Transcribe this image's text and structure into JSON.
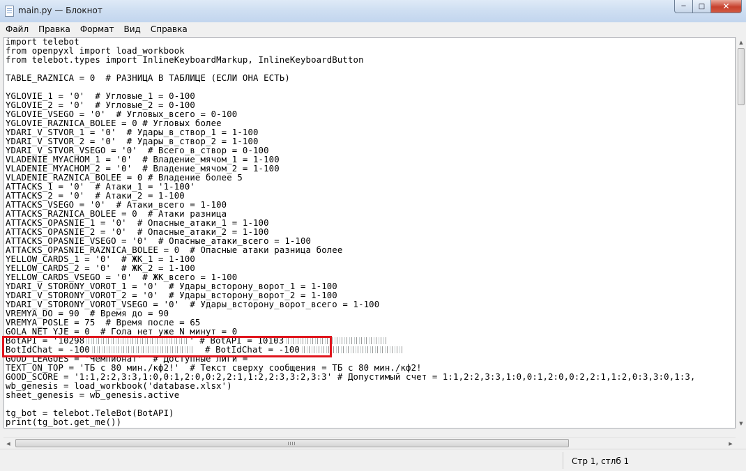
{
  "window": {
    "title": "main.py — Блокнот",
    "controls": {
      "minimize": "─",
      "maximize": "□",
      "close": "✕"
    }
  },
  "menu": [
    "Файл",
    "Правка",
    "Формат",
    "Вид",
    "Справка"
  ],
  "editor": {
    "lines": [
      "import telebot",
      "from openpyxl import load_workbook",
      "from telebot.types import InlineKeyboardMarkup, InlineKeyboardButton",
      "",
      "TABLE_RAZNICA = 0  # РАЗНИЦА В ТАБЛИЦЕ (ЕСЛИ ОНА ЕСТЬ)",
      "",
      "YGLOVIE_1 = '0'  # Угловые_1 = 0-100",
      "YGLOVIE_2 = '0'  # Угловые_2 = 0-100",
      "YGLOVIE_VSEGO = '0'  # Угловых_всего = 0-100",
      "YGLOVIE_RAZNICA_BOLEE = 0 # Угловых более",
      "YDARI_V_STVOR_1 = '0'  # Удары_в_створ_1 = 1-100",
      "YDARI_V_STVOR_2 = '0'  # Удары_в_створ_2 = 1-100",
      "YDARI_V_STVOR_VSEGO = '0'  # Всего_в_створ = 0-100",
      "VLADENIE_MYACHOM_1 = '0'  # Владение_мячом_1 = 1-100",
      "VLADENIE_MYACHOM_2 = '0'  # Владение_мячом_2 = 1-100",
      "VLADENIE_RAZNICA_BOLEE = 0 # Владение более 5",
      "ATTACKS_1 = '0'  # Атаки_1 = '1-100'",
      "ATTACKS_2 = '0'  # Атаки_2 = 1-100",
      "ATTACKS_VSEGO = '0'  # Атаки_всего = 1-100",
      "ATTACKS_RAZNICA_BOLEE = 0  # Атаки разница",
      "ATTACKS_OPASNIE_1 = '0'  # Опасные_атаки_1 = 1-100",
      "ATTACKS_OPASNIE_2 = '0'  # Опасные_атаки_2 = 1-100",
      "ATTACKS_OPASNIE_VSEGO = '0'  # Опасные_атаки_всего = 1-100",
      "ATTACKS_OPASNIE_RAZNICA_BOLEE = 0  # Опасные атаки разница более",
      "YELLOW_CARDS_1 = '0'  # ЖК_1 = 1-100",
      "YELLOW_CARDS_2 = '0'  # ЖК_2 = 1-100",
      "YELLOW_CARDS_VSEGO = '0'  # ЖК_всего = 1-100",
      "YDARI_V_STORONY_VOROT_1 = '0'  # Удары_всторону_ворот_1 = 1-100",
      "YDARI_V_STORONY_VOROT_2 = '0'  # Удары_всторону_ворот_2 = 1-100",
      "YDARI_V_STORONY_VOROT_VSEGO = '0'  # Удары_всторону_ворот_всего = 1-100",
      "VREMYA_DO = 90  # Время до = 90",
      "VREMYA_POSLE = 75  # Время после = 65",
      "GOLA_NET_YJE = 0  # Гола нет уже N минут = 0"
    ],
    "botapi_line": {
      "before": "BotAPI = '10298",
      "middle": "' # BotAPI = 10103",
      "after": ""
    },
    "botid_line": {
      "before": "BotIdChat = -100",
      "middle": "  # BotIdChat = -100",
      "after": ""
    },
    "lines_after": [
      "GOOD_LEAGUES = 'Чемпионат'  # Доступные лиги = ",
      "TEXT_ON_TOP = 'ТБ с 80 мин./кф2!'  # Текст сверху сообщения = ТБ с 80 мин./кф2!",
      "GOOD_SCORE = '1:1,2:2,3:3,1:0,0:1,2:0,0:2,2:1,1:2,2:3,3:2,3:3' # Допустимый счет = 1:1,2:2,3:3,1:0,0:1,2:0,0:2,2:1,1:2,0:3,3:0,1:3,",
      "wb_genesis = load_workbook('database.xlsx')",
      "sheet_genesis = wb_genesis.active",
      "",
      "tg_bot = telebot.TeleBot(BotAPI)",
      "print(tg_bot.get_me())"
    ]
  },
  "statusbar": {
    "position": "Стр 1, стлб 1"
  },
  "colors": {
    "highlight": "#e0141c",
    "titlebar": "#cfdff2",
    "close": "#c7412d"
  },
  "icons": {
    "app": "notepad-icon",
    "scroll_up": "arrow-up-icon",
    "scroll_down": "arrow-down-icon",
    "scroll_left": "arrow-left-icon",
    "scroll_right": "arrow-right-icon"
  }
}
